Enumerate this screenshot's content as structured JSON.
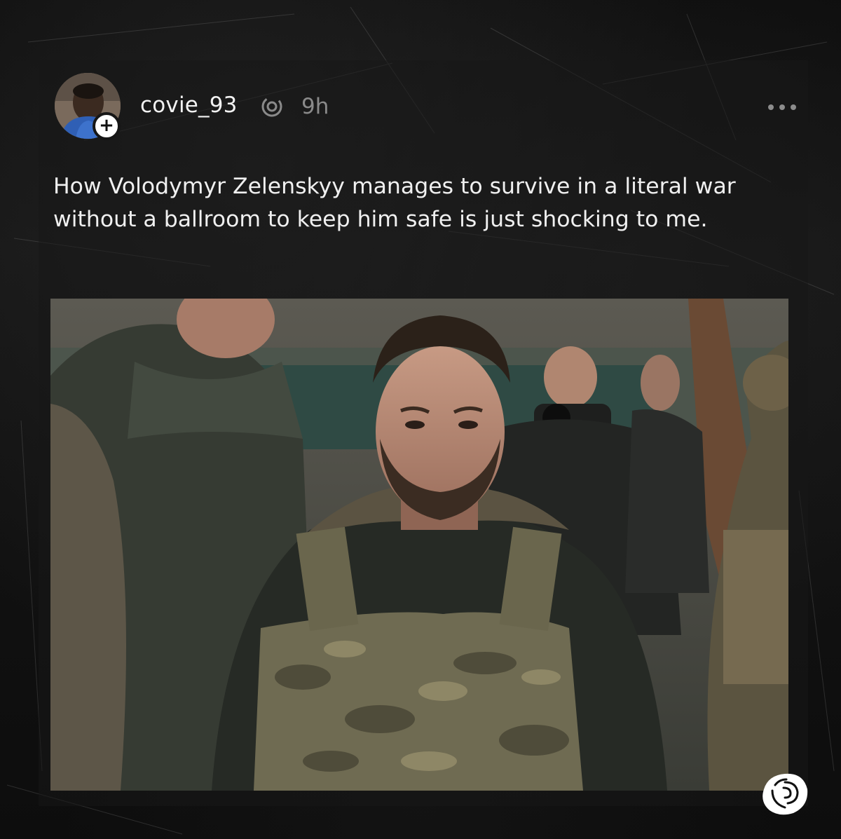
{
  "post": {
    "author": {
      "username": "covie_93",
      "avatar_icon": "avatar-photo",
      "follow_badge": "+"
    },
    "platform_icon": "threads-icon",
    "timestamp": "9h",
    "more_icon": "more-horizontal-icon",
    "text": "How Volodymyr Zelenskyy manages to survive in a literal war without a ballroom to keep him safe is just shocking to me.",
    "image_icon": "post-photo"
  },
  "watermark_icon": "rose-logo-icon",
  "colors": {
    "background": "#0c0c0c",
    "text": "#f0f0f0",
    "muted": "#8a8a8a"
  }
}
